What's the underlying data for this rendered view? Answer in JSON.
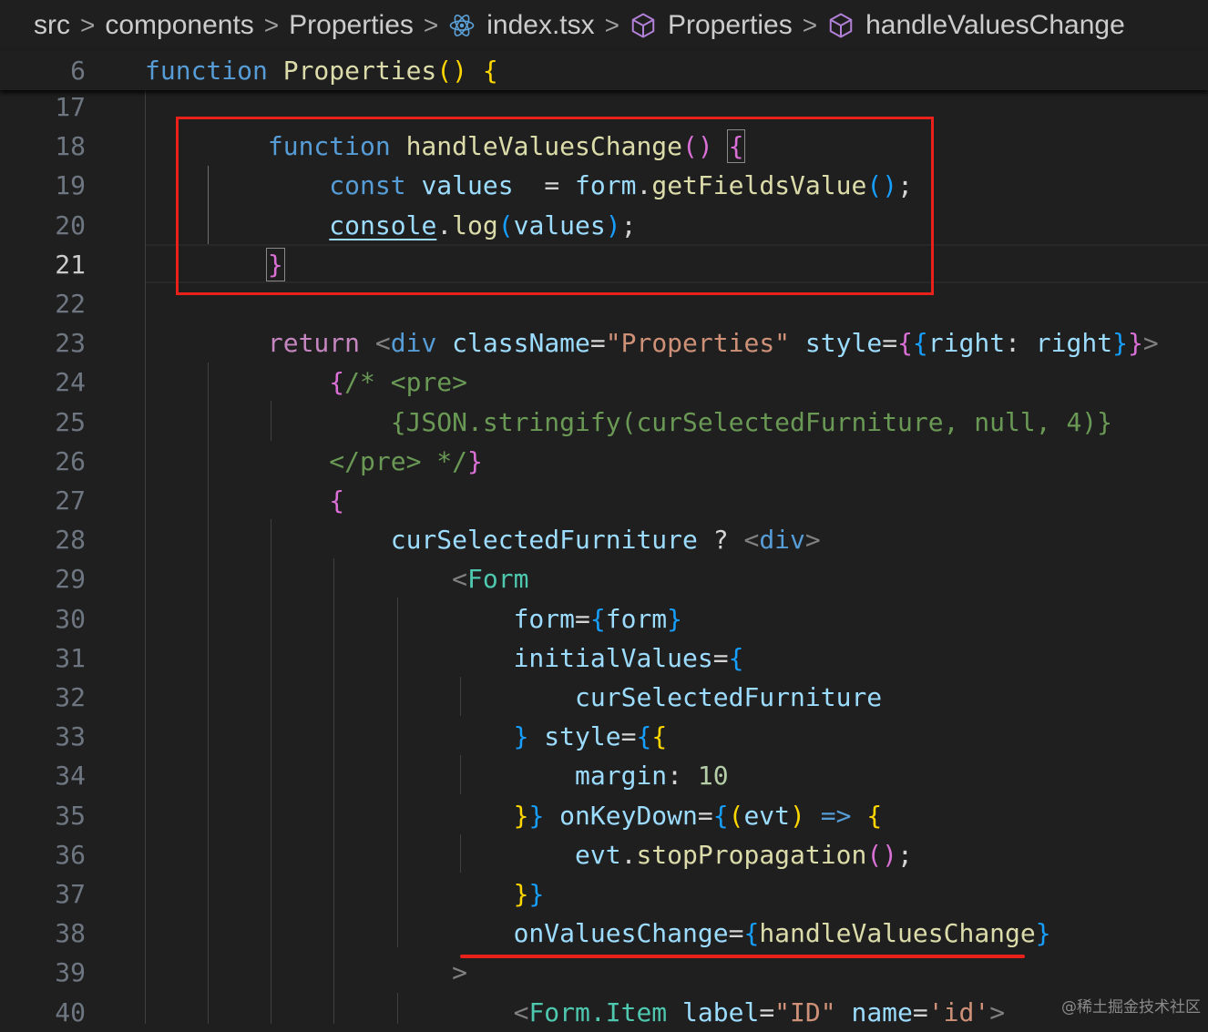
{
  "breadcrumb": {
    "items": [
      {
        "label": "src",
        "icon": ""
      },
      {
        "label": "components",
        "icon": ""
      },
      {
        "label": "Properties",
        "icon": ""
      },
      {
        "label": "index.tsx",
        "icon": "react-icon"
      },
      {
        "label": "Properties",
        "icon": "symbol-method-icon"
      },
      {
        "label": "handleValuesChange",
        "icon": "symbol-method-icon"
      }
    ],
    "separator": ">"
  },
  "sticky": {
    "line": "6",
    "tokens": [
      [
        "kw",
        "function"
      ],
      [
        "",
        " "
      ],
      [
        "fn",
        "Properties"
      ],
      [
        "y",
        "()"
      ],
      [
        "",
        " "
      ],
      [
        "y",
        "{"
      ]
    ]
  },
  "lines": [
    {
      "num": "17",
      "tokens": []
    },
    {
      "num": "18",
      "tokens": [
        [
          "",
          "        "
        ],
        [
          "kw",
          "function"
        ],
        [
          "",
          " "
        ],
        [
          "fn",
          "handleValuesChange"
        ],
        [
          "p",
          "()"
        ],
        [
          "",
          " "
        ],
        [
          "p bm",
          "{"
        ]
      ]
    },
    {
      "num": "19",
      "tokens": [
        [
          "",
          "            "
        ],
        [
          "kw",
          "const"
        ],
        [
          "",
          " "
        ],
        [
          "var",
          "values"
        ],
        [
          "",
          "  = "
        ],
        [
          "var",
          "form"
        ],
        [
          "",
          "."
        ],
        [
          "fn",
          "getFieldsValue"
        ],
        [
          "b",
          "()"
        ],
        [
          "",
          ";"
        ]
      ]
    },
    {
      "num": "20",
      "tokens": [
        [
          "",
          "            "
        ],
        [
          "var ul",
          "console"
        ],
        [
          "",
          "."
        ],
        [
          "fn",
          "log"
        ],
        [
          "b",
          "("
        ],
        [
          "var",
          "values"
        ],
        [
          "b",
          ")"
        ],
        [
          "",
          ";"
        ]
      ]
    },
    {
      "num": "21",
      "active": true,
      "tokens": [
        [
          "",
          "        "
        ],
        [
          "p bm",
          "}"
        ]
      ]
    },
    {
      "num": "22",
      "tokens": []
    },
    {
      "num": "23",
      "tokens": [
        [
          "",
          "        "
        ],
        [
          "ctl",
          "return"
        ],
        [
          "",
          " "
        ],
        [
          "punct",
          "<"
        ],
        [
          "tag",
          "div"
        ],
        [
          "",
          " "
        ],
        [
          "var",
          "className"
        ],
        [
          "",
          "="
        ],
        [
          "str",
          "\"Properties\""
        ],
        [
          "",
          " "
        ],
        [
          "var",
          "style"
        ],
        [
          "",
          "="
        ],
        [
          "p",
          "{"
        ],
        [
          "b",
          "{"
        ],
        [
          "var",
          "right"
        ],
        [
          "",
          ": "
        ],
        [
          "var",
          "right"
        ],
        [
          "b",
          "}"
        ],
        [
          "p",
          "}"
        ],
        [
          "punct",
          ">"
        ]
      ]
    },
    {
      "num": "24",
      "tokens": [
        [
          "",
          "            "
        ],
        [
          "p",
          "{"
        ],
        [
          "cmt",
          "/* <pre>"
        ]
      ]
    },
    {
      "num": "25",
      "tokens": [
        [
          "",
          "                "
        ],
        [
          "cmt",
          "{JSON.stringify(curSelectedFurniture, null, 4)}"
        ]
      ]
    },
    {
      "num": "26",
      "tokens": [
        [
          "",
          "            "
        ],
        [
          "cmt",
          "</pre> */"
        ],
        [
          "p",
          "}"
        ]
      ]
    },
    {
      "num": "27",
      "tokens": [
        [
          "",
          "            "
        ],
        [
          "p",
          "{"
        ]
      ]
    },
    {
      "num": "28",
      "tokens": [
        [
          "",
          "                "
        ],
        [
          "var",
          "curSelectedFurniture"
        ],
        [
          "",
          " ? "
        ],
        [
          "punct",
          "<"
        ],
        [
          "tag",
          "div"
        ],
        [
          "punct",
          ">"
        ]
      ]
    },
    {
      "num": "29",
      "tokens": [
        [
          "",
          "                    "
        ],
        [
          "punct",
          "<"
        ],
        [
          "comp",
          "Form"
        ]
      ]
    },
    {
      "num": "30",
      "tokens": [
        [
          "",
          "                        "
        ],
        [
          "var",
          "form"
        ],
        [
          "",
          "="
        ],
        [
          "b",
          "{"
        ],
        [
          "var",
          "form"
        ],
        [
          "b",
          "}"
        ]
      ]
    },
    {
      "num": "31",
      "tokens": [
        [
          "",
          "                        "
        ],
        [
          "var",
          "initialValues"
        ],
        [
          "",
          "="
        ],
        [
          "b",
          "{"
        ]
      ]
    },
    {
      "num": "32",
      "tokens": [
        [
          "",
          "                            "
        ],
        [
          "var",
          "curSelectedFurniture"
        ]
      ]
    },
    {
      "num": "33",
      "tokens": [
        [
          "",
          "                        "
        ],
        [
          "b",
          "}"
        ],
        [
          "",
          " "
        ],
        [
          "var",
          "style"
        ],
        [
          "",
          "="
        ],
        [
          "b",
          "{"
        ],
        [
          "y",
          "{"
        ]
      ]
    },
    {
      "num": "34",
      "tokens": [
        [
          "",
          "                            "
        ],
        [
          "var",
          "margin"
        ],
        [
          "",
          ": "
        ],
        [
          "num",
          "10"
        ]
      ]
    },
    {
      "num": "35",
      "tokens": [
        [
          "",
          "                        "
        ],
        [
          "y",
          "}"
        ],
        [
          "b",
          "}"
        ],
        [
          "",
          " "
        ],
        [
          "var",
          "onKeyDown"
        ],
        [
          "",
          "="
        ],
        [
          "b",
          "{"
        ],
        [
          "y",
          "("
        ],
        [
          "var",
          "evt"
        ],
        [
          "y",
          ")"
        ],
        [
          "",
          " "
        ],
        [
          "kw",
          "=>"
        ],
        [
          "",
          " "
        ],
        [
          "y",
          "{"
        ]
      ]
    },
    {
      "num": "36",
      "tokens": [
        [
          "",
          "                            "
        ],
        [
          "var",
          "evt"
        ],
        [
          "",
          "."
        ],
        [
          "fn",
          "stopPropagation"
        ],
        [
          "p",
          "()"
        ],
        [
          "",
          ";"
        ]
      ]
    },
    {
      "num": "37",
      "tokens": [
        [
          "",
          "                        "
        ],
        [
          "y",
          "}"
        ],
        [
          "b",
          "}"
        ]
      ]
    },
    {
      "num": "38",
      "tokens": [
        [
          "",
          "                        "
        ],
        [
          "var",
          "onValuesChange"
        ],
        [
          "",
          "="
        ],
        [
          "b",
          "{"
        ],
        [
          "fn",
          "handleValuesChange"
        ],
        [
          "b",
          "}"
        ]
      ]
    },
    {
      "num": "39",
      "tokens": [
        [
          "",
          "                    "
        ],
        [
          "punct",
          ">"
        ]
      ]
    },
    {
      "num": "40",
      "tokens": [
        [
          "",
          "                        "
        ],
        [
          "punct",
          "<"
        ],
        [
          "comp",
          "Form.Item"
        ],
        [
          "",
          " "
        ],
        [
          "var",
          "label"
        ],
        [
          "",
          "="
        ],
        [
          "str",
          "\"ID\""
        ],
        [
          "",
          " "
        ],
        [
          "var",
          "name"
        ],
        [
          "",
          "="
        ],
        [
          "str",
          "'id'"
        ],
        [
          "punct",
          ">"
        ]
      ]
    }
  ],
  "watermark": "@稀土掘金技术社区"
}
